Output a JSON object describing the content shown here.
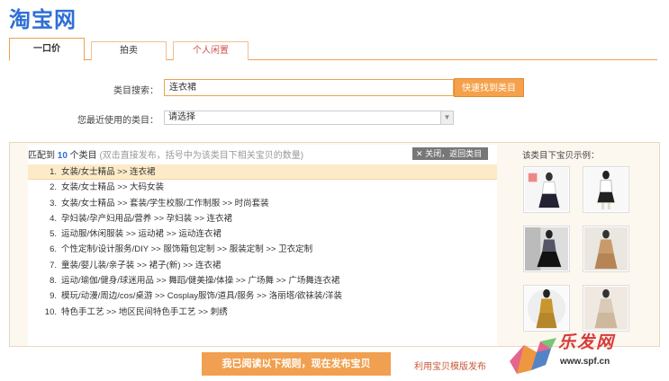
{
  "logo": "淘宝网",
  "tabs": [
    {
      "label": "一口价"
    },
    {
      "label": "拍卖"
    },
    {
      "label": "个人闲置"
    }
  ],
  "category_search": {
    "label": "类目搜索：",
    "value": "连衣裙",
    "button": "快速找到类目"
  },
  "recent_category": {
    "label": "您最近使用的类目：",
    "value": "请选择"
  },
  "results": {
    "prefix": "匹配到 ",
    "count": "10",
    "suffix": " 个类目",
    "hint": "(双击直接发布，括号中为该类目下相关宝贝的数量)",
    "close_label": "关闭，返回类目",
    "items": [
      {
        "num": "1.",
        "text": "女装/女士精品 >> 连衣裙"
      },
      {
        "num": "2.",
        "text": "女装/女士精品 >> 大码女装"
      },
      {
        "num": "3.",
        "text": "女装/女士精品 >> 套装/学生校服/工作制服 >> 时尚套装"
      },
      {
        "num": "4.",
        "text": "孕妇装/孕产妇用品/营养 >> 孕妇装 >> 连衣裙"
      },
      {
        "num": "5.",
        "text": "运动服/休闲服装 >> 运动裙 >> 运动连衣裙"
      },
      {
        "num": "6.",
        "text": "个性定制/设计服务/DIY >> 服饰箱包定制 >> 服装定制 >> 卫衣定制"
      },
      {
        "num": "7.",
        "text": "童装/婴儿装/亲子装 >> 裙子(新) >> 连衣裙"
      },
      {
        "num": "8.",
        "text": "运动/瑜伽/健身/球迷用品 >> 舞蹈/健美操/体操 >> 广场舞 >> 广场舞连衣裙"
      },
      {
        "num": "9.",
        "text": "模玩/动漫/周边/cos/桌游 >> Cosplay服饰/道具/服务 >> 洛丽塔/欲袜装/洋装"
      },
      {
        "num": "10.",
        "text": "特色手工艺 >> 地区民间特色手工艺 >> 刺绣"
      }
    ]
  },
  "examples": {
    "title": "该类目下宝贝示例："
  },
  "publish_button": "我已阅读以下规则，现在发布宝贝",
  "template_link": "利用宝贝模版发布",
  "watermark": {
    "brand": "乐发网",
    "url": "www.spf.cn"
  },
  "colors": {
    "accent": "#f0a050",
    "brand_blue": "#2f6fd6",
    "link_red": "#c85a3a"
  }
}
